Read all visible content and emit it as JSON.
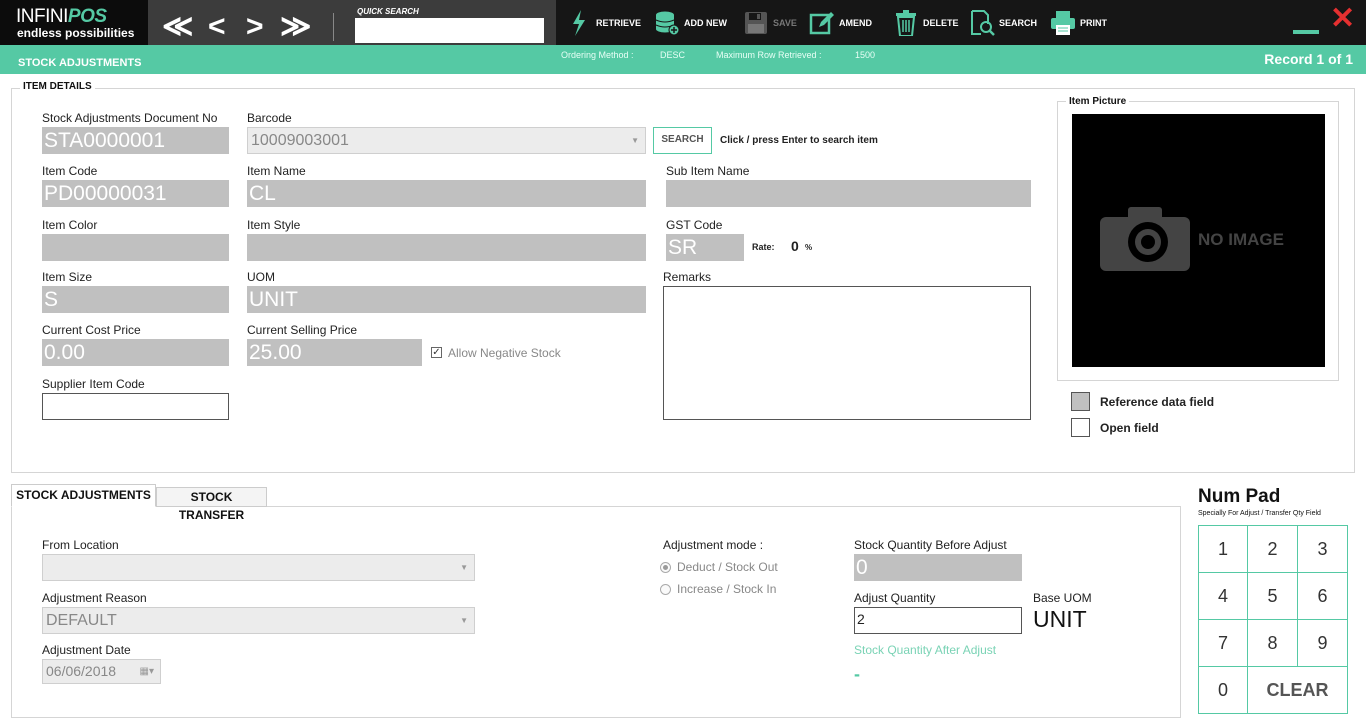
{
  "logo": {
    "name_part1": "INFINI",
    "name_part2": "POS",
    "tagline": "endless possibilities"
  },
  "nav": {
    "first": "≪",
    "prev": "<",
    "next": ">",
    "last": "≫"
  },
  "quick_search": {
    "label": "QUICK SEARCH",
    "value": "",
    "placeholder": ""
  },
  "toolbar": {
    "retrieve": "RETRIEVE",
    "add_new": "ADD NEW",
    "save": "SAVE",
    "amend": "AMEND",
    "delete": "DELETE",
    "search": "SEARCH",
    "print": "PRINT"
  },
  "window": {
    "close_glyph": "✕"
  },
  "strip": {
    "title": "STOCK ADJUSTMENTS",
    "ordering_label": "Ordering Method :",
    "ordering_value": "DESC",
    "max_label": "Maximum Row Retrieved :",
    "max_value": "1500",
    "record": "Record 1 of 1"
  },
  "item_details": {
    "title": "ITEM DETAILS",
    "doc_no_label": "Stock Adjustments Document No",
    "doc_no": "STA0000001",
    "barcode_label": "Barcode",
    "barcode": "10009003001",
    "search_button": "SEARCH",
    "search_hint": "Click / press Enter to search item",
    "item_code_label": "Item Code",
    "item_code": "PD00000031",
    "item_name_label": "Item Name",
    "item_name": "CL",
    "sub_item_name_label": "Sub Item Name",
    "sub_item_name": "",
    "item_color_label": "Item Color",
    "item_color": "",
    "item_style_label": "Item Style",
    "item_style": "",
    "gst_code_label": "GST Code",
    "gst_code": "SR",
    "rate_label": "Rate:",
    "rate_value": "0",
    "rate_unit": "%",
    "item_size_label": "Item Size",
    "item_size": "S",
    "uom_label": "UOM",
    "uom": "UNIT",
    "remarks_label": "Remarks",
    "remarks": "",
    "cost_price_label": "Current Cost Price",
    "cost_price": "0.00",
    "selling_price_label": "Current Selling Price",
    "selling_price": "25.00",
    "allow_negative_label": "Allow Negative Stock",
    "allow_negative_checked": true,
    "supplier_code_label": "Supplier Item Code",
    "supplier_code": ""
  },
  "item_picture": {
    "title": "Item Picture",
    "no_image_text": "NO IMAGE",
    "legend_reference": "Reference data field",
    "legend_open": "Open field"
  },
  "tabs": [
    {
      "label": "STOCK ADJUSTMENTS",
      "active": true
    },
    {
      "label": "STOCK TRANSFER",
      "active": false
    }
  ],
  "adjustment": {
    "from_location_label": "From Location",
    "from_location": "",
    "reason_label": "Adjustment Reason",
    "reason": "DEFAULT",
    "date_label": "Adjustment Date",
    "date": "06/06/2018",
    "mode_label": "Adjustment mode :",
    "mode_options": [
      "Deduct / Stock Out",
      "Increase / Stock In"
    ],
    "mode_selected": "Deduct / Stock Out",
    "qty_before_label": "Stock Quantity Before Adjust",
    "qty_before": "0",
    "adjust_qty_label": "Adjust Quantity",
    "adjust_qty": "2",
    "base_uom_label": "Base UOM",
    "base_uom": "UNIT",
    "qty_after_label": "Stock Quantity After Adjust",
    "qty_after": "-"
  },
  "numpad": {
    "title": "Num Pad",
    "subtitle": "Specially For Adjust / Transfer Qty Field",
    "keys": [
      "1",
      "2",
      "3",
      "4",
      "5",
      "6",
      "7",
      "8",
      "9",
      "0"
    ],
    "clear": "CLEAR"
  },
  "colors": {
    "accent": "#55c9a4",
    "topbar": "#161616",
    "reference_field": "#c0c0c0",
    "close": "#e53030"
  }
}
